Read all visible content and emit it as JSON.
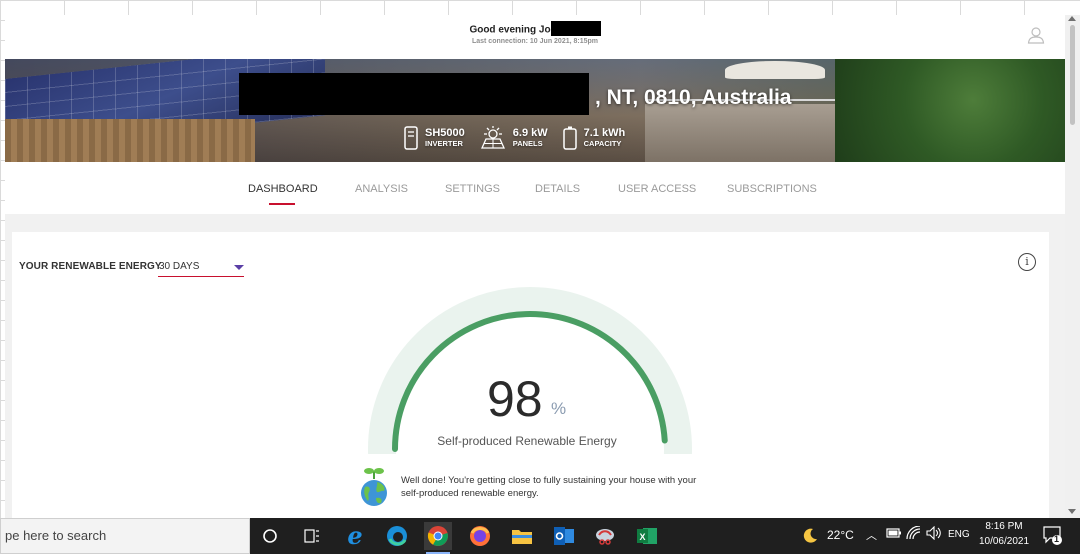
{
  "header": {
    "greeting": "Good evening Jo",
    "last_connection": "Last connection: 10 Jun 2021, 8:15pm"
  },
  "banner": {
    "address": ", NT, 0810, Australia",
    "specs": [
      {
        "value": "SH5000",
        "label": "INVERTER",
        "icon": "inverter-icon"
      },
      {
        "value": "6.9 kW",
        "label": "PANELS",
        "icon": "solar-panel-icon"
      },
      {
        "value": "7.1 kWh",
        "label": "CAPACITY",
        "icon": "battery-icon"
      }
    ]
  },
  "tabs": [
    {
      "label": "DASHBOARD",
      "active": true
    },
    {
      "label": "ANALYSIS",
      "active": false
    },
    {
      "label": "SETTINGS",
      "active": false
    },
    {
      "label": "DETAILS",
      "active": false
    },
    {
      "label": "USER ACCESS",
      "active": false
    },
    {
      "label": "SUBSCRIPTIONS",
      "active": false
    }
  ],
  "card": {
    "title": "YOUR RENEWABLE ENERGY",
    "period": "30 DAYS",
    "gauge": {
      "value": "98",
      "unit": "%",
      "fraction": 0.98,
      "label": "Self-produced Renewable Energy",
      "track_color": "#eaf3ee",
      "fill_color": "#4a9e63"
    },
    "tip": "Well done! You're getting close to fully sustaining your house with your self-produced renewable energy."
  },
  "colors": {
    "accent": "#c8102e",
    "caret": "#5a3fa6"
  },
  "taskbar": {
    "search_placeholder": "pe here to search",
    "apps": [
      "cortana-icon",
      "task-view-icon",
      "internet-explorer-icon",
      "edge-icon",
      "chrome-icon",
      "firefox-icon",
      "file-explorer-icon",
      "outlook-icon",
      "snipping-tool-icon",
      "excel-icon"
    ],
    "temperature": "22°C",
    "language": "ENG",
    "time": "8:16 PM",
    "date": "10/06/2021",
    "notification_count": "1"
  }
}
